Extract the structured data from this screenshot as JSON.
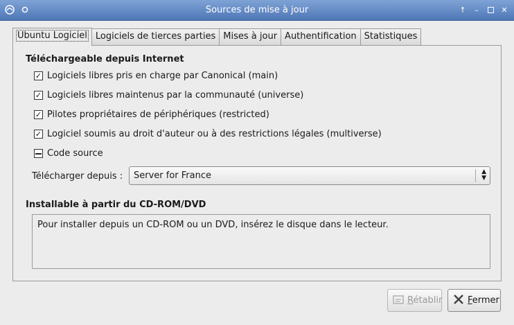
{
  "window": {
    "title": "Sources de mise à jour"
  },
  "tabs": [
    {
      "label": "Ubuntu Logiciel",
      "active": true
    },
    {
      "label": "Logiciels de tierces parties"
    },
    {
      "label": "Mises à jour"
    },
    {
      "label": "Authentification"
    },
    {
      "label": "Statistiques"
    }
  ],
  "internet": {
    "title": "Téléchargeable depuis Internet",
    "items": [
      {
        "label": "Logiciels libres pris en charge par Canonical (main)",
        "state": "checked"
      },
      {
        "label": "Logiciels libres maintenus par la communauté (universe)",
        "state": "checked"
      },
      {
        "label": "Pilotes propriétaires de périphériques (restricted)",
        "state": "checked"
      },
      {
        "label": "Logiciel soumis au droit d'auteur ou à des restrictions légales (multiverse)",
        "state": "checked"
      },
      {
        "label": "Code source",
        "state": "partial"
      }
    ],
    "download_label": "Télécharger depuis :",
    "download_value": "Server for France"
  },
  "cdrom": {
    "title": "Installable à partir du CD-ROM/DVD",
    "message": "Pour installer depuis un CD-ROM ou un DVD, insérez le disque dans le lecteur."
  },
  "buttons": {
    "revert_mnemonic": "R",
    "revert_rest": "établir",
    "close_mnemonic": "F",
    "close_rest": "ermer"
  }
}
